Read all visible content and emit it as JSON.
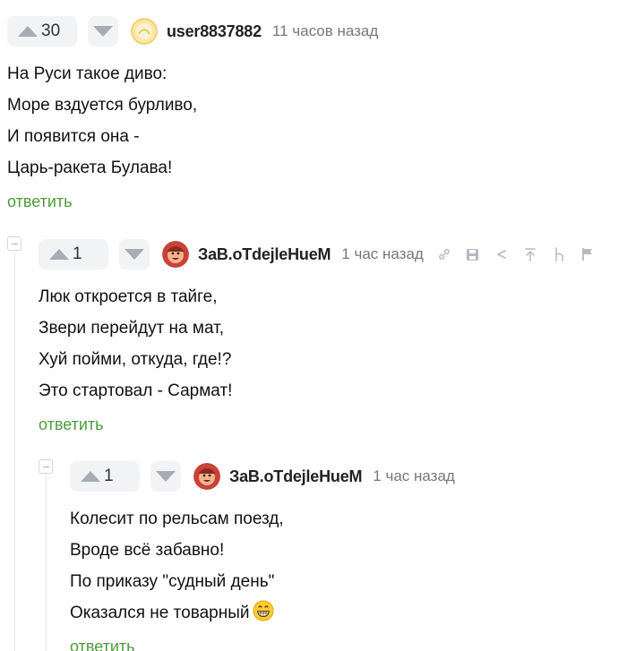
{
  "comments": [
    {
      "rating": "30",
      "username": "user8837882",
      "time": "11 часов назад",
      "lines": [
        "На Руси такое диво:",
        "Море вздуется бурливо,",
        "И появится она -",
        "Царь-ракета Булава!"
      ],
      "reply": "ответить"
    },
    {
      "rating": "1",
      "username": "ЗаВ.оТdejleHueM",
      "time": "1 час назад",
      "lines": [
        "Люк откроется в тайге,",
        "Звери перейдут на мат,",
        "Хуй пойми, откуда, где!?",
        "Это стартовал - Сармат!"
      ],
      "reply": "ответить"
    },
    {
      "rating": "1",
      "username": "ЗаВ.оТdejleHueM",
      "time": "1 час назад",
      "lines": [
        "Колесит по рельсам поезд,",
        "Вроде всё забавно!",
        "По приказу \"судный день\"",
        "Оказался не товарный"
      ],
      "reply": "ответить"
    }
  ],
  "icons": {
    "upvote": "triangle-up-icon",
    "downvote": "triangle-down-icon",
    "toolbar": [
      "link-icon",
      "save-icon",
      "share-icon",
      "scroll-up-icon",
      "parent-icon",
      "flag-icon"
    ],
    "emoji": "grinning-face-icon"
  },
  "colors": {
    "reply_link": "#4d9a3a",
    "vote_bg": "#f2f3f5",
    "muted_text": "#777777"
  }
}
